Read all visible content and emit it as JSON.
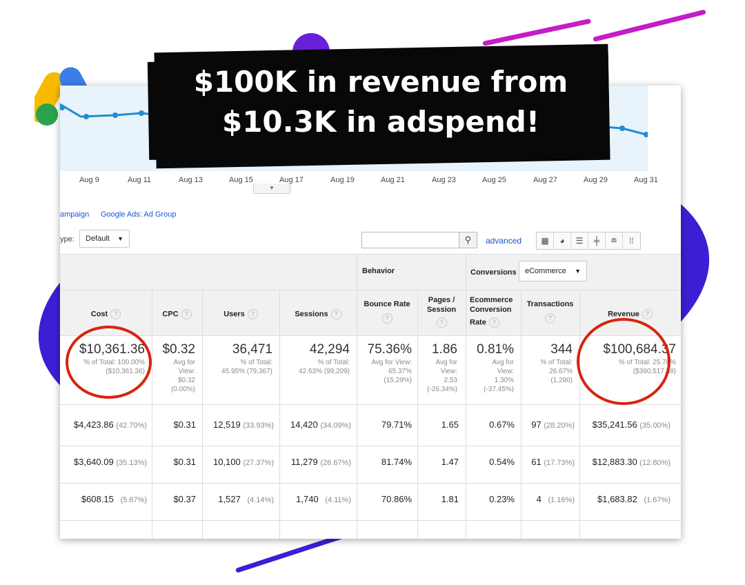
{
  "banner": {
    "line1": "$100K in revenue from",
    "line2": "$10.3K in adspend!"
  },
  "colors": {
    "blob": "#3b1fd4",
    "accent_stroke": "#c41dc6",
    "circle": "#d8230f",
    "link": "#1a55c9",
    "chart_line": "#1d8cd1"
  },
  "chart": {
    "dates": [
      "Aug 9",
      "Aug 11",
      "Aug 13",
      "Aug 15",
      "Aug 17",
      "Aug 19",
      "Aug 21",
      "Aug 23",
      "Aug 25",
      "Aug 27",
      "Aug 29",
      "Aug 31"
    ]
  },
  "tabs": {
    "campaign": "ampaign",
    "ad_group": "Google Ads: Ad Group"
  },
  "toolbar": {
    "type_label": "ype:",
    "type_value": "Default",
    "advanced": "advanced",
    "view_icons": [
      "grid-view-icon",
      "pie-view-icon",
      "bar-view-icon",
      "comparison-view-icon",
      "term-cloud-icon",
      "pivot-view-icon"
    ]
  },
  "table": {
    "behavior_group": "Behavior",
    "conversions_label": "Conversions",
    "conversions_select": "eCommerce",
    "columns": {
      "cost": "Cost",
      "cpc": "CPC",
      "users": "Users",
      "sessions": "Sessions",
      "bounce_rate": "Bounce Rate",
      "pages_session_1": "Pages /",
      "pages_session_2": "Session",
      "ecr_1": "Ecommerce",
      "ecr_2": "Conversion",
      "ecr_3": "Rate",
      "transactions": "Transactions",
      "revenue": "Revenue"
    },
    "totals": {
      "cost": {
        "value": "$10,361.36",
        "l1": "% of Total: 100.00%",
        "l2": "($10,361.36)"
      },
      "cpc": {
        "value": "$0.32",
        "l1": "Avg for",
        "l2": "View:",
        "l3": "$0.32",
        "l4": "(0.00%)"
      },
      "users": {
        "value": "36,471",
        "l1": "% of Total:",
        "l2": "45.95% (79,367)"
      },
      "sessions": {
        "value": "42,294",
        "l1": "% of Total:",
        "l2": "42.63% (99,209)"
      },
      "bounce": {
        "value": "75.36%",
        "l1": "Avg for View:",
        "l2": "65.37%",
        "l3": "(15.29%)"
      },
      "pages": {
        "value": "1.86",
        "l1": "Avg for",
        "l2": "View:",
        "l3": "2.53",
        "l4": "(-26.34%)"
      },
      "ecr": {
        "value": "0.81%",
        "l1": "Avg for",
        "l2": "View:",
        "l3": "1.30%",
        "l4": "(-37.45%)"
      },
      "transactions": {
        "value": "344",
        "l1": "% of Total:",
        "l2": "26.67%",
        "l3": "(1,290)"
      },
      "revenue": {
        "value": "$100,684.37",
        "l1": "% of Total: 25.78%",
        "l2": "($390,517.88)"
      }
    },
    "rows": [
      {
        "cost": "$4,423.86",
        "cost_pct": "(42.70%)",
        "cpc": "$0.31",
        "users": "12,519",
        "users_pct": "(33.93%)",
        "sessions": "14,420",
        "sessions_pct": "(34.09%)",
        "bounce": "79.71%",
        "pages": "1.65",
        "ecr": "0.67%",
        "transactions": "97",
        "transactions_pct": "(28.20%)",
        "revenue": "$35,241.56",
        "revenue_pct": "(35.00%)"
      },
      {
        "cost": "$3,640.09",
        "cost_pct": "(35.13%)",
        "cpc": "$0.31",
        "users": "10,100",
        "users_pct": "(27.37%)",
        "sessions": "11,279",
        "sessions_pct": "(26.67%)",
        "bounce": "81.74%",
        "pages": "1.47",
        "ecr": "0.54%",
        "transactions": "61",
        "transactions_pct": "(17.73%)",
        "revenue": "$12,883.30",
        "revenue_pct": "(12.80%)"
      },
      {
        "cost": "$608.15",
        "cost_pct": "(5.87%)",
        "cpc": "$0.37",
        "users": "1,527",
        "users_pct": "(4.14%)",
        "sessions": "1,740",
        "sessions_pct": "(4.11%)",
        "bounce": "70.86%",
        "pages": "1.81",
        "ecr": "0.23%",
        "transactions": "4",
        "transactions_pct": "(1.16%)",
        "revenue": "$1,683.82",
        "revenue_pct": "(1.67%)"
      }
    ]
  }
}
